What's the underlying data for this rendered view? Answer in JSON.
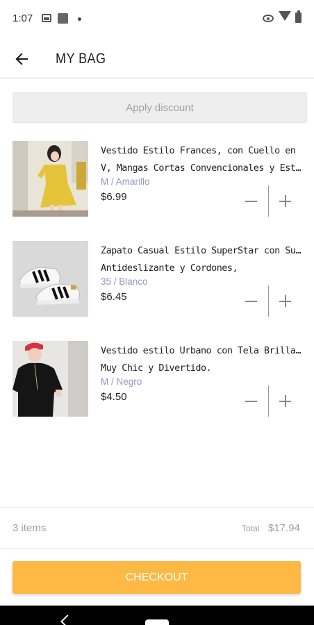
{
  "status_bar": {
    "time": "1:07",
    "icons": [
      "image-icon",
      "square-icon",
      "dot-icon",
      "eye-icon",
      "wifi-icon",
      "battery-icon"
    ]
  },
  "app_bar": {
    "title": "MY BAG",
    "back_icon": "arrow-left-icon"
  },
  "discount": {
    "label": "Apply discount"
  },
  "items": [
    {
      "name_line1": "Vestido Estilo Frances, con Cuello en",
      "name_line2": "V, Mangas Cortas Convencionales y Esta…",
      "variant": "M / Amarillo",
      "price": "$6.99",
      "image": "yellow-dress-photo"
    },
    {
      "name_line1": "Zapato Casual Estilo SuperStar con Suela",
      "name_line2": "Antideslizante y Cordones,",
      "variant": "35 / Blanco",
      "price": "$6.45",
      "image": "white-sneakers-photo"
    },
    {
      "name_line1": "Vestido estilo Urbano con Tela Brillante.",
      "name_line2": "Muy Chic y Divertido.",
      "variant": "M / Negro",
      "price": "$4.50",
      "image": "black-dress-photo"
    }
  ],
  "summary": {
    "items_count": "3 items",
    "total_label": "Total",
    "total_value": "$17.94"
  },
  "checkout": {
    "label": "CHECKOUT"
  },
  "colors": {
    "accent": "#fdb944",
    "variant_text": "#8f99c4",
    "muted_text": "#9aa0aa"
  }
}
